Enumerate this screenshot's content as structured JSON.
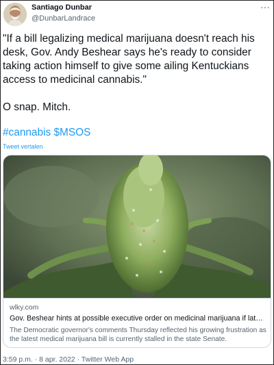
{
  "author": {
    "name": "Santiago Dunbar",
    "handle": "@DunbarLandrace"
  },
  "tweet": {
    "text_line1": "\"If a bill legalizing medical marijuana doesn't reach his desk, Gov. Andy Beshear says he's ready to consider taking action himself to give some ailing Kentuckians access to medicinal cannabis.\"",
    "text_line2": "O snap. Mitch.",
    "hashtag1": "#cannabis",
    "hashtag2": "$MSOS",
    "translate_label": "Tweet vertalen"
  },
  "card": {
    "domain": "wlky.com",
    "title": "Gov. Beshear hints at possible executive order on medicinal marijuana if latest ...",
    "description": "The Democratic governor's comments Thursday reflected his growing frustration as the latest medical marijuana bill is currently stalled in the state Senate.",
    "image_subject": "cannabis-plant-photo"
  },
  "meta": {
    "timestamp": "3:59 p.m. · 8 apr. 2022 · Twitter Web App"
  },
  "colors": {
    "link": "#1d9bf0",
    "secondary_text": "#536471",
    "primary_text": "#0f1419"
  }
}
